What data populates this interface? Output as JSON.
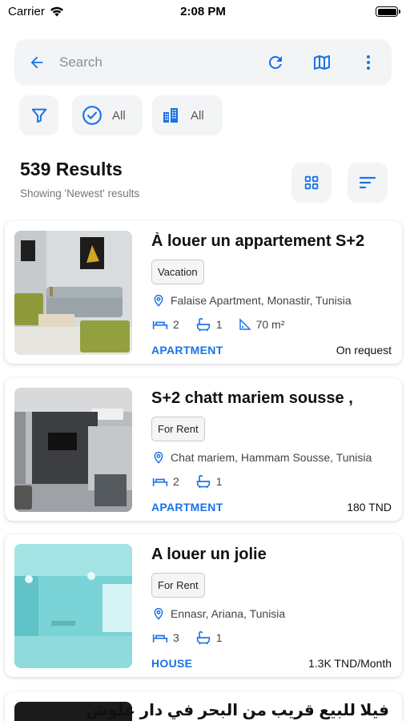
{
  "status_bar": {
    "carrier": "Carrier",
    "time": "2:08 PM",
    "battery_level": 1.0
  },
  "search": {
    "placeholder": "Search",
    "icons": [
      "arrow-back-icon",
      "refresh-icon",
      "map-icon",
      "more-vert-icon"
    ]
  },
  "filters": [
    {
      "icon": "filter-icon",
      "label": ""
    },
    {
      "icon": "check-circle-icon",
      "label": "All"
    },
    {
      "icon": "buildings-icon",
      "label": "All"
    }
  ],
  "results": {
    "title": "539 Results",
    "subtitle": "Showing 'Newest' results"
  },
  "accent_color": "#1a73e8",
  "listings": [
    {
      "title": "À louer un appartement S+2",
      "badge": "Vacation",
      "location": "Falaise Apartment, Monastir, Tunisia",
      "bedrooms": "2",
      "bathrooms": "1",
      "area": "70 m²",
      "type": "APARTMENT",
      "price": "On request"
    },
    {
      "title": "S+2 chatt mariem sousse ,",
      "badge": "For Rent",
      "location": "Chat mariem, Hammam Sousse, Tunisia",
      "bedrooms": "2",
      "bathrooms": "1",
      "type": "APARTMENT",
      "price": "180 TND"
    },
    {
      "title": "A louer un jolie",
      "badge": "For Rent",
      "location": "Ennasr, Ariana, Tunisia",
      "bedrooms": "3",
      "bathrooms": "1",
      "type": "HOUSE",
      "price": "1.3K TND/Month"
    }
  ],
  "partial_listing": {
    "title": "فيلا للبيع قريب من البحر في دار علوش"
  }
}
